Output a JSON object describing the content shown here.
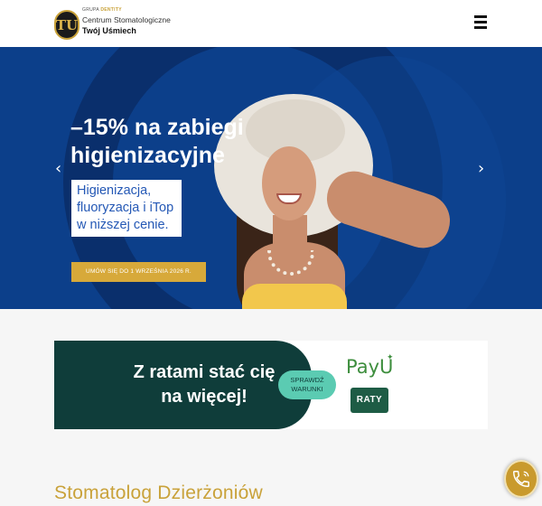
{
  "header": {
    "logo_mark": "TU",
    "group_prefix": "GRUPA",
    "group_brand": "DENTITY",
    "clinic_line1": "Centrum Stomatologiczne",
    "clinic_line2": "Twój Uśmiech",
    "menu_icon": "hamburger-menu-icon"
  },
  "hero": {
    "title": "–15% na zabiegi higienizacyjne",
    "subtitle": "Higienizacja, fluoryzacja i iTop w niższej cenie.",
    "cta_label": "UMÓW SIĘ DO 1 WRZEŚNIA 2026 R.",
    "prev_arrow": "‹",
    "next_arrow": "›",
    "background_color": "#0c3f8a",
    "cta_color": "#d7a93a"
  },
  "banner": {
    "headline": "Z ratami stać cię na więcej!",
    "button_label": "SPRAWDŹ WARUNKI",
    "brand": "PayU",
    "badge": "RATY",
    "dark_color": "#0f3d3a",
    "accent_color": "#5bcbb2"
  },
  "section": {
    "title": "Stomatolog Dzierżoniów",
    "title_color": "#c9a23a"
  },
  "floating": {
    "phone_icon": "phone-ringing-icon"
  }
}
